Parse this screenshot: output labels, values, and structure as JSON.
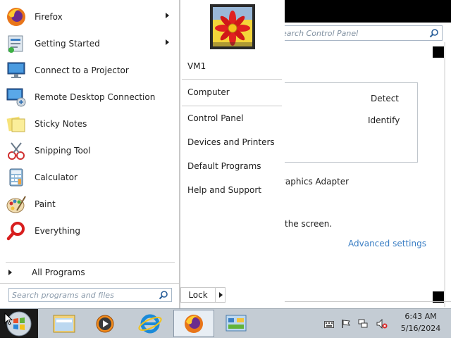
{
  "control_panel": {
    "search_placeholder": "Search Control Panel",
    "search_text_visible": "earch Control Panel",
    "detect_label": "Detect",
    "identify_label": "Identify",
    "adapter_text": "raphics Adapter",
    "screen_text": "the screen.",
    "advanced_settings_label": "Advanced settings"
  },
  "start_menu": {
    "programs": [
      {
        "label": "Firefox",
        "icon": "firefox-icon",
        "has_submenu": true
      },
      {
        "label": "Getting Started",
        "icon": "getting-started-icon",
        "has_submenu": true
      },
      {
        "label": "Connect to a Projector",
        "icon": "projector-icon",
        "has_submenu": false
      },
      {
        "label": "Remote Desktop Connection",
        "icon": "remote-desktop-icon",
        "has_submenu": false
      },
      {
        "label": "Sticky Notes",
        "icon": "sticky-notes-icon",
        "has_submenu": false
      },
      {
        "label": "Snipping Tool",
        "icon": "snipping-tool-icon",
        "has_submenu": false
      },
      {
        "label": "Calculator",
        "icon": "calculator-icon",
        "has_submenu": false
      },
      {
        "label": "Paint",
        "icon": "paint-icon",
        "has_submenu": false
      },
      {
        "label": "Everything",
        "icon": "everything-icon",
        "has_submenu": false
      }
    ],
    "all_programs_label": "All Programs",
    "search_placeholder": "Search programs and files",
    "right_pane": {
      "user_name": "VM1",
      "items": [
        "Computer",
        "Control Panel",
        "Devices and Printers",
        "Default Programs",
        "Help and Support"
      ]
    },
    "lock_label": "Lock"
  },
  "taskbar": {
    "pinned": [
      "explorer-icon",
      "media-player-icon",
      "internet-explorer-icon",
      "firefox-icon",
      "control-panel-icon"
    ],
    "clock_time": "6:43 AM",
    "clock_date": "5/16/2024"
  },
  "colors": {
    "accent_link": "#3a7ec4",
    "taskbar": "#c4ccd4",
    "firefox_orange": "#e8751a"
  }
}
